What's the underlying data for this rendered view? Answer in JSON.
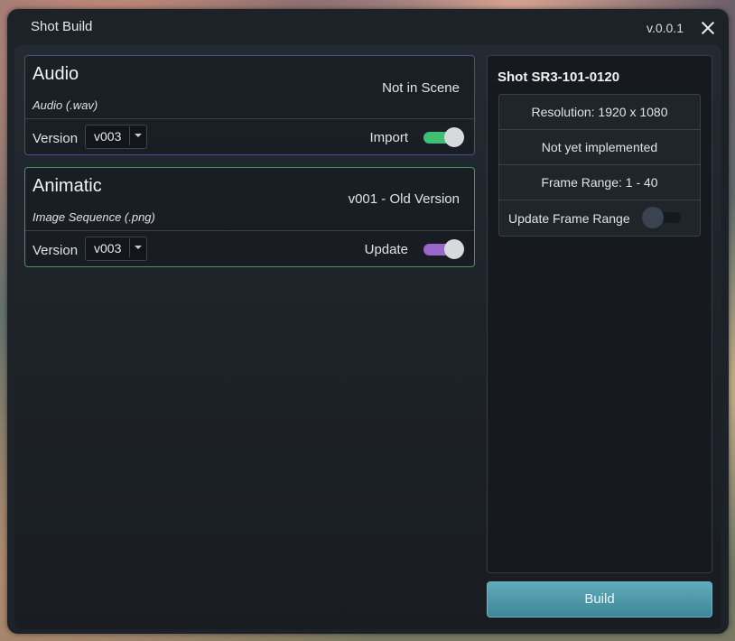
{
  "window": {
    "title": "Shot Build",
    "version": "v.0.0.1"
  },
  "assets": [
    {
      "name": "Audio",
      "type_label": "Audio  (.wav)",
      "status": "Not in Scene",
      "version_label": "Version",
      "version_value": "v003",
      "action_label": "Import",
      "toggle_on": true,
      "accent_color": "#3fbf72",
      "border_color": "#4a4f8a"
    },
    {
      "name": "Animatic",
      "type_label": "Image Sequence  (.png)",
      "status": "v001 - Old Version",
      "version_label": "Version",
      "version_value": "v003",
      "action_label": "Update",
      "toggle_on": true,
      "accent_color": "#9966cc",
      "border_color": "#3b9a5c"
    }
  ],
  "shot_panel": {
    "title": "Shot SR3-101-0120",
    "resolution": "Resolution: 1920 x 1080",
    "note": "Not yet implemented",
    "frame_range": "Frame Range: 1 - 40",
    "update_frame_range_label": "Update Frame Range",
    "update_frame_range_on": false
  },
  "build_button_label": "Build",
  "icons": {
    "close": "close-icon",
    "dropdown": "chevron-down-icon"
  }
}
